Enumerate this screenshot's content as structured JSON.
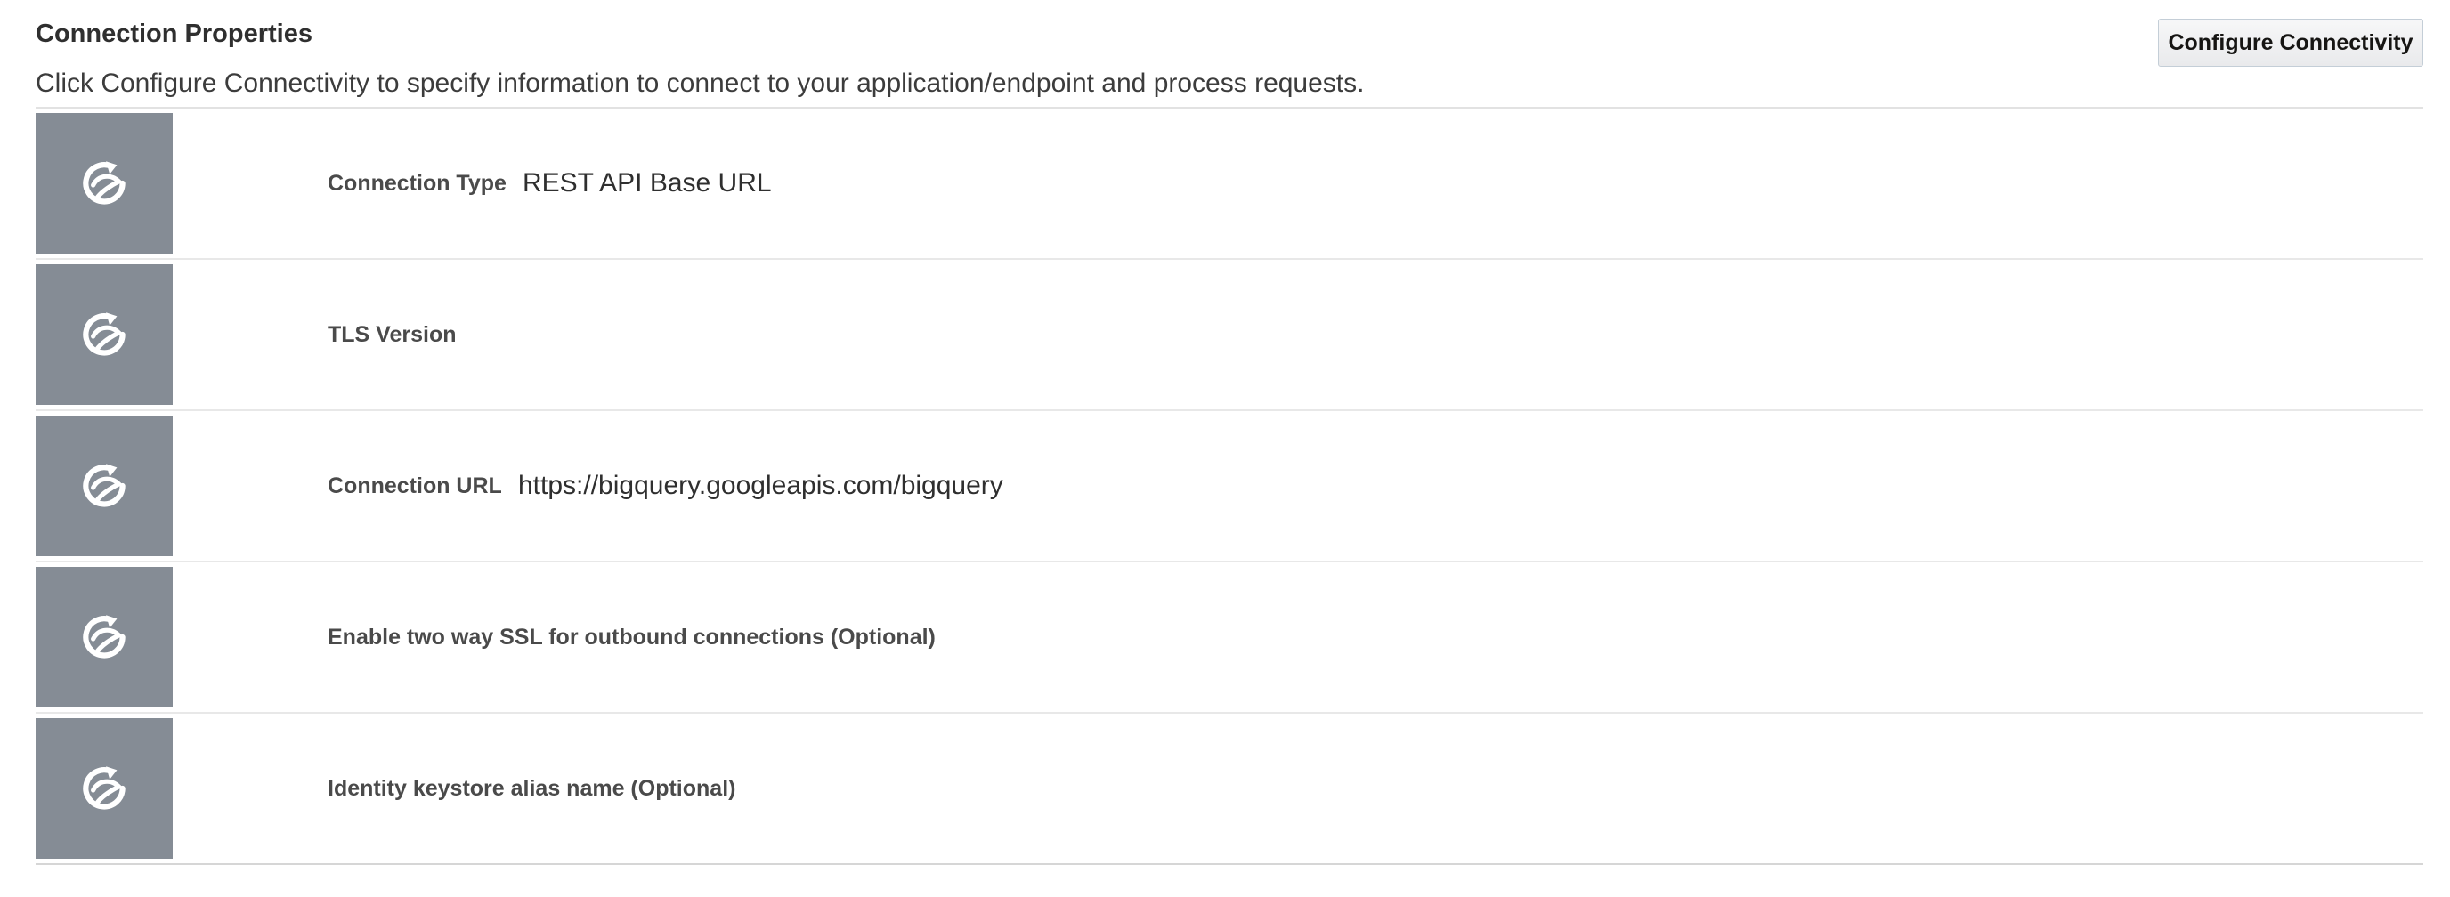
{
  "section": {
    "title": "Connection Properties",
    "description": "Click Configure Connectivity to specify information to connect to your application/endpoint and process requests.",
    "configure_button": "Configure Connectivity"
  },
  "properties": [
    {
      "label": "Connection Type",
      "value": "REST API Base URL",
      "icon": "property-icon"
    },
    {
      "label": "TLS Version",
      "value": "",
      "icon": "property-icon"
    },
    {
      "label": "Connection URL",
      "value": "https://bigquery.googleapis.com/bigquery",
      "icon": "property-icon"
    },
    {
      "label": "Enable two way SSL for outbound connections (Optional)",
      "value": "",
      "icon": "property-icon"
    },
    {
      "label": "Identity keystore alias name (Optional)",
      "value": "",
      "icon": "property-icon"
    }
  ],
  "colors": {
    "icon_tile": "#858c95",
    "divider": "#e8e8e8",
    "button_border": "#c4ced7"
  }
}
